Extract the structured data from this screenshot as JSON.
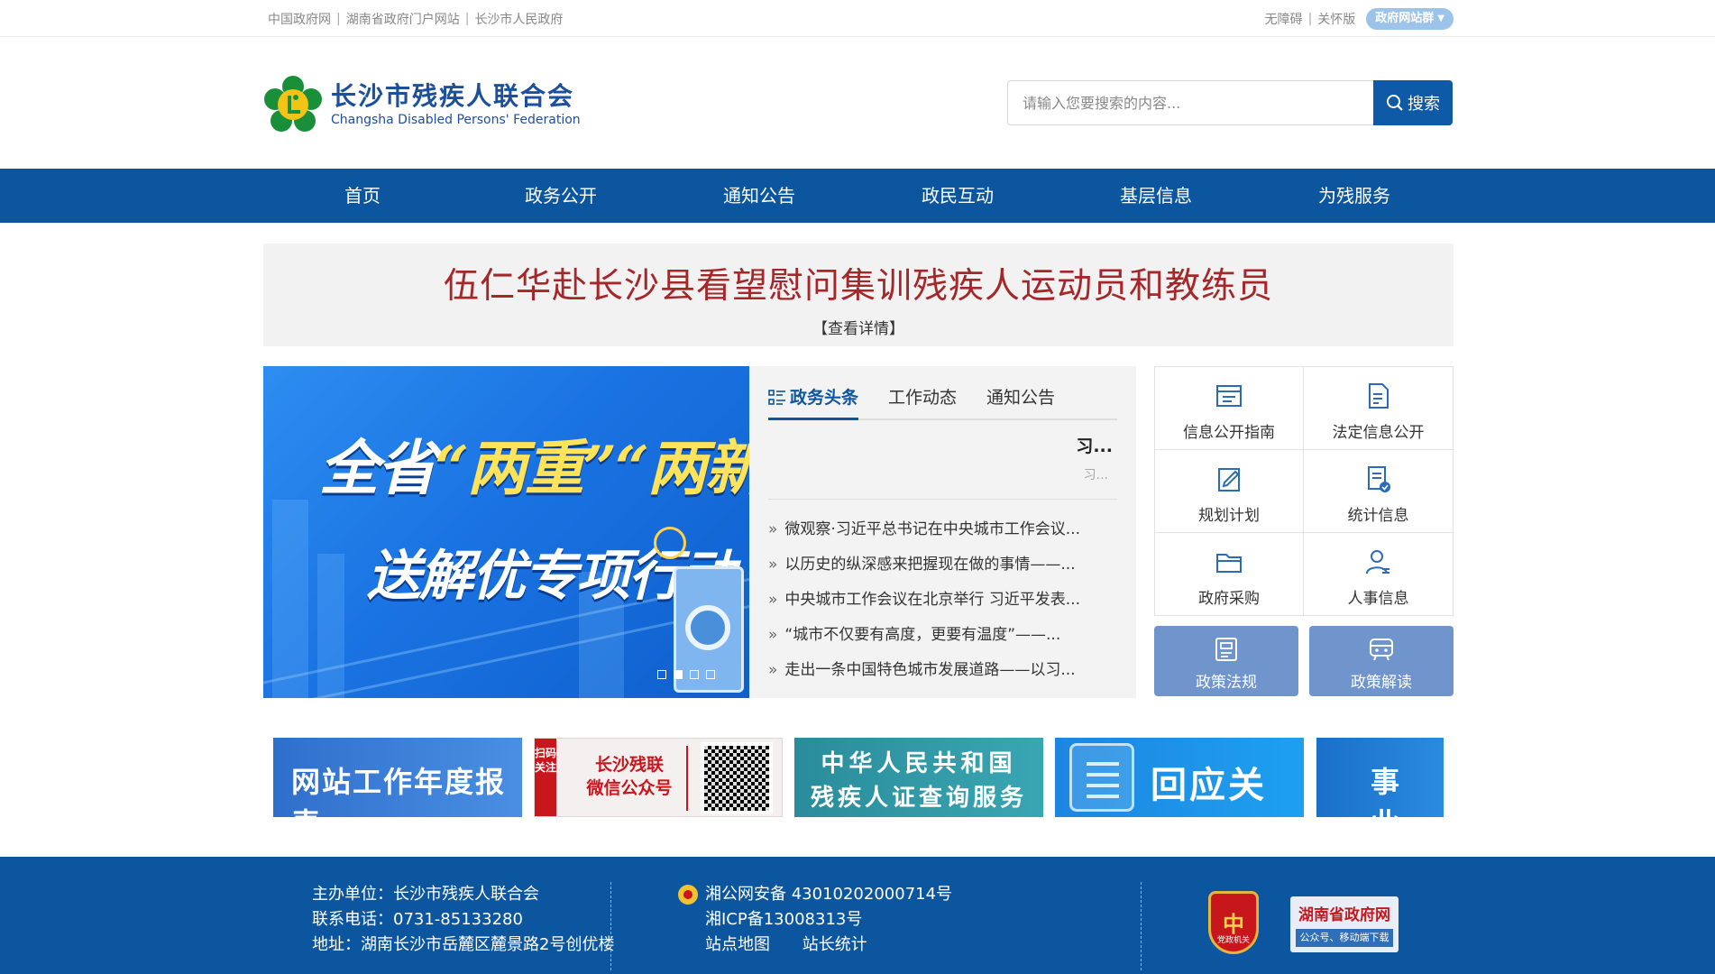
{
  "topbar": {
    "links": [
      "中国政府网",
      "湖南省政府门户网站",
      "长沙市人民政府"
    ],
    "accessibility": "无障碍",
    "elder_mode": "关怀版",
    "gov_group": "政府网站群"
  },
  "header": {
    "site_name_cn": "长沙市残疾人联合会",
    "site_name_en": "Changsha Disabled Persons' Federation",
    "search_placeholder": "请输入您要搜索的内容...",
    "search_button": "搜索"
  },
  "nav": [
    "首页",
    "政务公开",
    "通知公告",
    "政民互动",
    "基层信息",
    "为残服务"
  ],
  "headline": {
    "title": "伍仁华赴长沙县看望慰问集训残疾人运动员和教练员",
    "more": "【查看详情】"
  },
  "carousel": {
    "line1_prefix": "全省",
    "line1_q1": "“两重”",
    "line1_q2": "“两新”",
    "line2": "送解优专项行动",
    "dots": 4,
    "active_dot": 1
  },
  "news": {
    "tabs": [
      "政务头条",
      "工作动态",
      "通知公告"
    ],
    "active_tab": 0,
    "feature_title": "习...",
    "feature_sub": "习...",
    "items": [
      "微观察·习近平总书记在中央城市工作会议...",
      "以历史的纵深感来把握现在做的事情——...",
      "中央城市工作会议在北京举行 习近平发表...",
      "“城市不仅要有高度，更要有温度”——...",
      "走出一条中国特色城市发展道路——以习..."
    ]
  },
  "quick": {
    "cells": [
      {
        "label": "信息公开指南",
        "icon": "info-guide-icon"
      },
      {
        "label": "法定信息公开",
        "icon": "legal-info-icon"
      },
      {
        "label": "规划计划",
        "icon": "plan-icon"
      },
      {
        "label": "统计信息",
        "icon": "statistics-icon"
      },
      {
        "label": "政府采购",
        "icon": "procurement-icon"
      },
      {
        "label": "人事信息",
        "icon": "personnel-icon"
      }
    ],
    "buttons": [
      {
        "label": "政策法规",
        "icon": "policy-law-icon"
      },
      {
        "label": "政策解读",
        "icon": "policy-interpret-icon"
      }
    ]
  },
  "banners": {
    "annual_report": "网站工作年度报表",
    "wechat_tag": "扫码关注",
    "wechat_line1": "长沙残联",
    "wechat_line2": "微信公众号",
    "cert_line1": "中华人民共和国",
    "cert_line2": "残疾人证查询服务",
    "respond": "回应关切",
    "career": "事业"
  },
  "footer": {
    "host": "主办单位：长沙市残疾人联合会",
    "phone": "联系电话：0731-85133280",
    "address": "地址：湖南长沙市岳麓区麓景路2号创优楼",
    "police_record": "湘公网安备 43010202000714号",
    "icp": "湘ICP备13008313号",
    "sitemap": "站点地图",
    "stats": "站长统计",
    "badge_char": "中",
    "badge_text": "党政机关",
    "hn_title": "湖南省政府网",
    "hn_sub": "公众号、移动端下载"
  },
  "colors": {
    "primary": "#0c569f",
    "headline_red": "#a4282a",
    "quick_button": "#6f95cc"
  }
}
